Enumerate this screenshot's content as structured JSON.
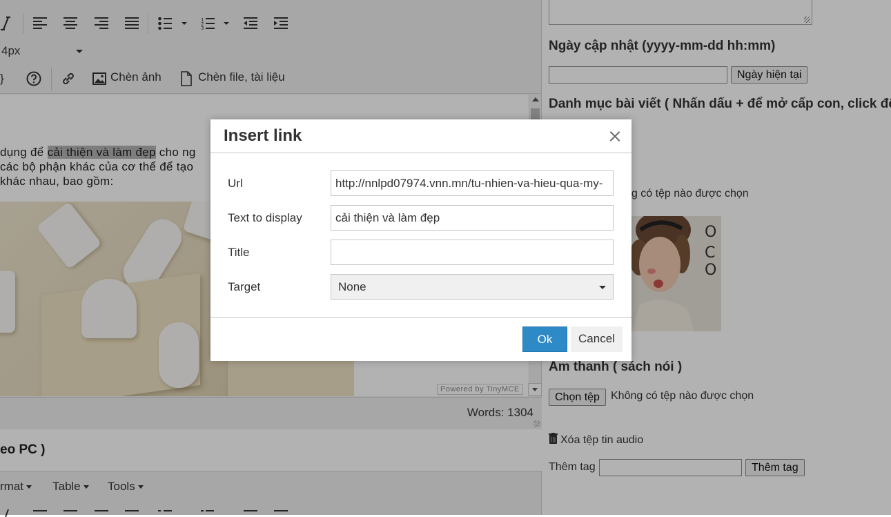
{
  "editor": {
    "font_size": "4px",
    "insert_image_label": "Chèn ảnh",
    "insert_file_label": "Chèn file, tài liệu",
    "content_line1_pre": "dụng để ",
    "content_line1_hl": "cải thiện và làm đẹp",
    "content_line1_post": " cho ng",
    "content_line2": "các bộ phận khác của cơ thể để tạo",
    "content_line3": "khác nhau, bao gồm:",
    "powered_by": "Powered by TinyMCE",
    "words": "Words: 1304"
  },
  "section2": {
    "title": "eo PC )",
    "menu": [
      "rmat",
      "Table",
      "Tools"
    ]
  },
  "right": {
    "updated_label": "Ngày cập nhật (yyyy-mm-dd hh:mm)",
    "now_button": "Ngày hiện tại",
    "category_label": "Danh mục bài viết ( Nhấn dấu + để mở cấp con, click để",
    "no_file_text_1": "ng có tệp nào được chọn",
    "audio_label": "Âm thanh ( sách nói )",
    "choose_file_button": "Chọn tệp",
    "no_file_text_2": "Không có tệp nào được chọn",
    "delete_audio": "Xóa tệp tin audio",
    "tag_label": "Thêm tag",
    "tag_button": "Thêm tag"
  },
  "dialog": {
    "title": "Insert link",
    "url_label": "Url",
    "url_value": "http://nnlpd07974.vnn.mn/tu-nhien-va-hieu-qua-my-",
    "text_label": "Text to display",
    "text_value": "cải thiện và làm đẹp",
    "title_label": "Title",
    "title_value": "",
    "target_label": "Target",
    "target_value": "None",
    "ok": "Ok",
    "cancel": "Cancel"
  },
  "colors": {
    "primary_button": "#2d8ac7",
    "overlay": "rgba(0,0,0,0.30)"
  }
}
